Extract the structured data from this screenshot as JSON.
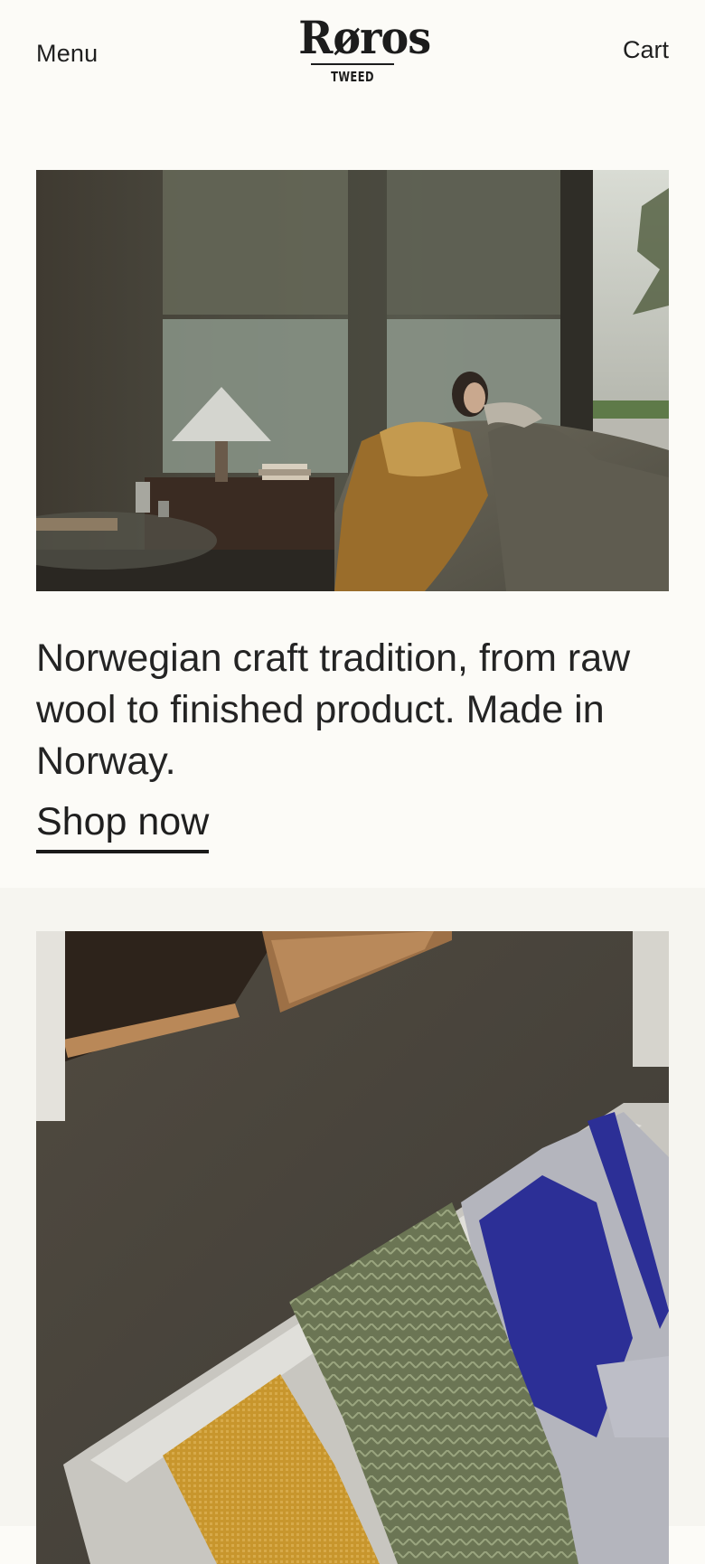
{
  "header": {
    "menu_label": "Menu",
    "cart_label": "Cart",
    "logo": {
      "word": "Røros",
      "sub": "TWEED"
    }
  },
  "hero": {
    "image_name": "living-room-blanket-photo",
    "tagline": "Norwegian craft tradition, from raw wool to finished product. Made in Norway.",
    "cta_label": "Shop now"
  },
  "second_section": {
    "image_name": "blankets-on-sofa-photo"
  },
  "colors": {
    "background": "#fcfbf7",
    "section_background": "#f6f5f0",
    "text": "#1f1f1f",
    "underline": "#1a1a1a"
  }
}
